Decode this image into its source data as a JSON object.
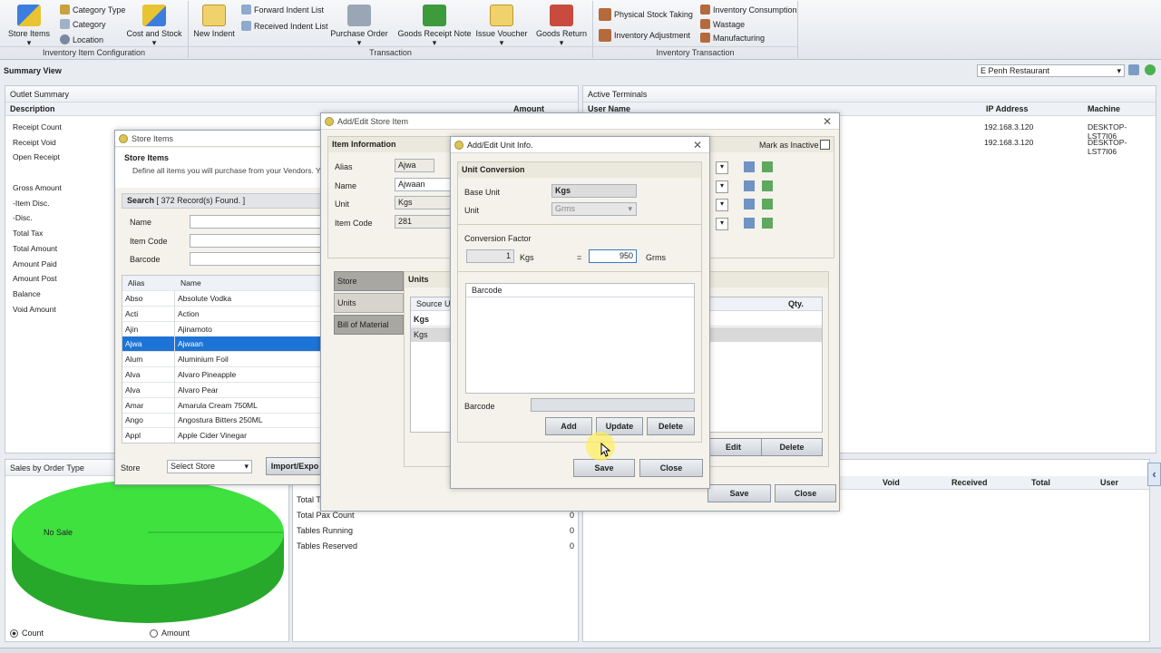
{
  "ribbon": {
    "store_items": "Store Items",
    "category_type": "Category Type",
    "category": "Category",
    "location": "Location",
    "cost_and_stock": "Cost and Stock",
    "group1_label": "Inventory Item Configuration",
    "new_indent": "New Indent",
    "forward_indent_list": "Forward Indent List",
    "received_indent_list": "Received Indent List",
    "purchase_order": "Purchase Order",
    "goods_receipt_note": "Goods Receipt Note",
    "issue_voucher": "Issue Voucher",
    "goods_return": "Goods Return",
    "group2_label": "Transaction",
    "physical_stock_taking": "Physical Stock Taking",
    "inventory_adjustment": "Inventory Adjustment",
    "inventory_consumption": "Inventory Consumption",
    "wastage": "Wastage",
    "manufacturing": "Manufacturing",
    "group3_label": "Inventory Transaction"
  },
  "summary_view": "Summary View",
  "outlet_select": "E Penh Restaurant",
  "outlet_summary": {
    "title": "Outlet Summary",
    "col_description": "Description",
    "col_amount": "Amount",
    "rows": [
      "Receipt Count",
      "Receipt Void",
      "Open Receipt",
      "Gross Amount",
      "-Item Disc.",
      "-Disc.",
      "Total Tax",
      "Total Amount",
      "Amount Paid",
      "Amount Post",
      "Balance",
      "Void Amount"
    ]
  },
  "active_terminals": {
    "title": "Active Terminals",
    "col_user": "User Name",
    "col_ip": "IP Address",
    "col_machine": "Machine",
    "rows": [
      {
        "ip": "192.168.3.120",
        "machine": "DESKTOP-LST7I06"
      },
      {
        "ip": "192.168.3.120",
        "machine": "DESKTOP-LST7I06"
      }
    ]
  },
  "sales_panel": {
    "title": "Sales by Order Type",
    "no_sale": "No Sale",
    "radio_count": "Count",
    "radio_amount": "Amount"
  },
  "tables_panel": {
    "rows": [
      {
        "label": "Total Pax Count",
        "value": "0"
      },
      {
        "label": "Tables Running",
        "value": "0"
      },
      {
        "label": "Tables Reserved",
        "value": "0"
      }
    ]
  },
  "void_panel": {
    "col_void": "Void",
    "col_received": "Received",
    "col_total": "Total",
    "col_user": "User"
  },
  "store_items_win": {
    "title": "Store Items",
    "heading": "Store Items",
    "subtitle": "Define all items you will purchase from your Vendors. You",
    "search": "Search",
    "found": "[ 372 Record(s) Found. ]",
    "lbl_name": "Name",
    "lbl_item_code": "Item Code",
    "lbl_barcode": "Barcode",
    "col_alias": "Alias",
    "col_name": "Name",
    "rows": [
      {
        "alias": "Abso",
        "name": "Absolute Vodka"
      },
      {
        "alias": "Acti",
        "name": "Action"
      },
      {
        "alias": "Ajin",
        "name": "Ajinamoto"
      },
      {
        "alias": "Ajwa",
        "name": "Ajwaan"
      },
      {
        "alias": "Alum",
        "name": "Aluminium Foil"
      },
      {
        "alias": "Alva",
        "name": "Alvaro  Pineapple"
      },
      {
        "alias": "Alva",
        "name": "Alvaro Pear"
      },
      {
        "alias": "Amar",
        "name": "Amarula Cream 750ML"
      },
      {
        "alias": "Ango",
        "name": "Angostura Bitters 250ML"
      },
      {
        "alias": "Appl",
        "name": "Apple Cider Vinegar"
      }
    ],
    "lbl_store": "Store",
    "select_store": "Select Store",
    "import_btn": "Import/Expo"
  },
  "edit_store_win": {
    "title": "Add/Edit Store Item",
    "item_information": "Item Information",
    "mark_inactive": "Mark as Inactive",
    "lbl_alias": "Alias",
    "alias": "Ajwa",
    "lbl_name": "Name",
    "name": "Ajwaan",
    "lbl_unit": "Unit",
    "unit": "Kgs",
    "lbl_item_code": "Item Code",
    "item_code": "281",
    "tab_store": "Store",
    "tab_units": "Units",
    "tab_bom": "Bill of Material",
    "units_header": "Units",
    "source_unit": "Source Un",
    "kgs_bold": "Kgs",
    "kgs": "Kgs",
    "qty": "Qty.",
    "edit": "Edit",
    "delete": "Delete",
    "save": "Save",
    "close": "Close"
  },
  "unit_dialog": {
    "title": "Add/Edit Unit Info.",
    "unit_conversion": "Unit Conversion",
    "lbl_base_unit": "Base Unit",
    "base_unit": "Kgs",
    "lbl_unit": "Unit",
    "unit": "Grms",
    "conversion_factor": "Conversion Factor",
    "factor_left": "1",
    "factor_left_unit": "Kgs",
    "equals": "=",
    "factor_right": "950",
    "factor_right_unit": "Grms",
    "barcode_col": "Barcode",
    "lbl_barcode": "Barcode",
    "add": "Add",
    "update": "Update",
    "delete": "Delete",
    "save": "Save",
    "close": "Close"
  }
}
